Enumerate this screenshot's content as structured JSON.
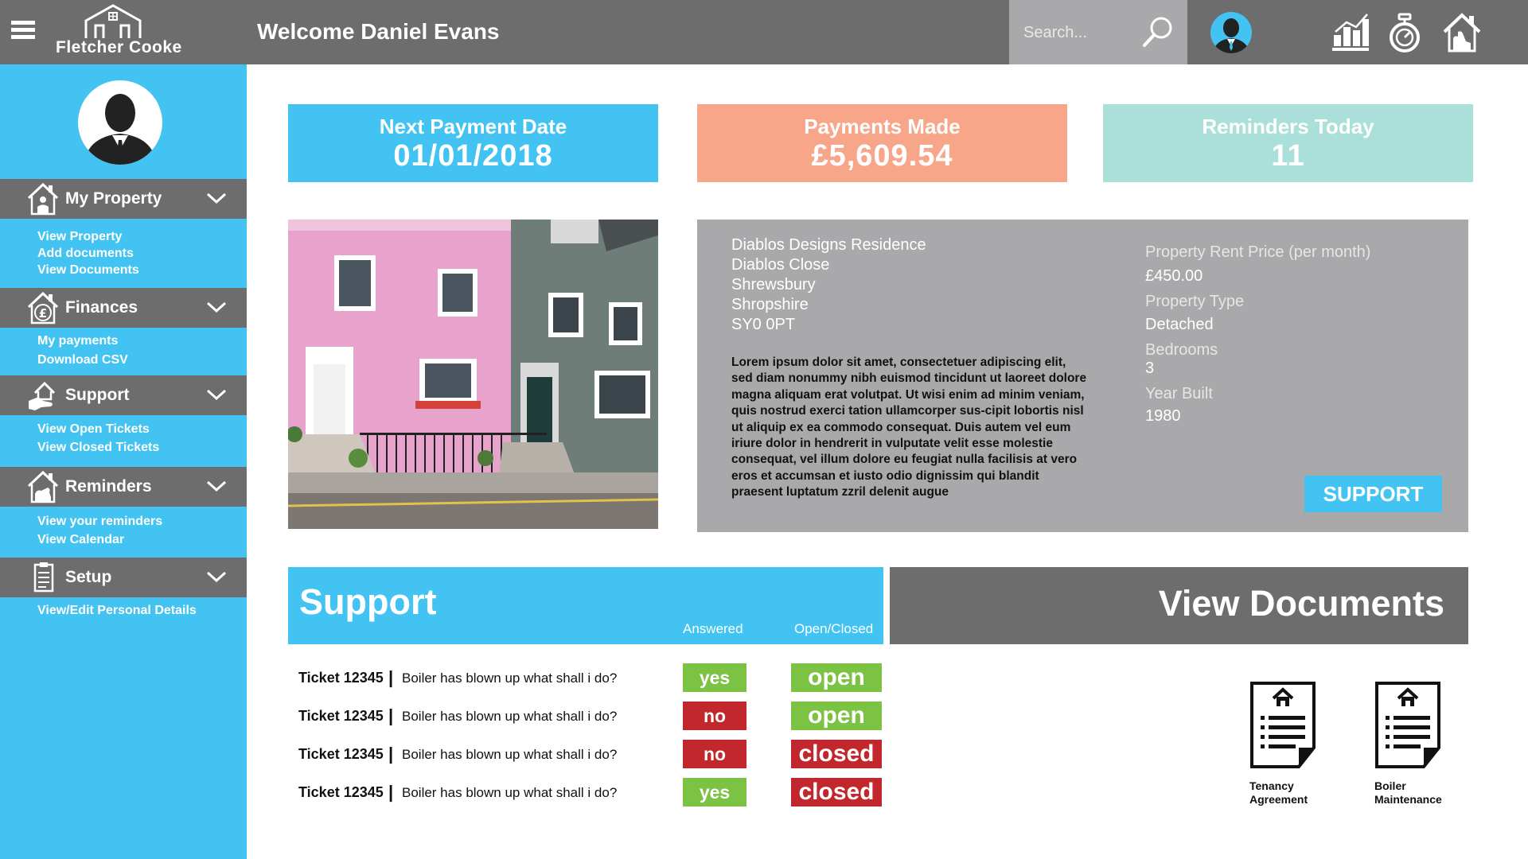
{
  "header": {
    "brand": "Fletcher Cooke",
    "welcome": "Welcome Daniel Evans",
    "search_placeholder": "Search...",
    "icons": [
      "menu-icon",
      "search-icon",
      "user-avatar",
      "stats-icon",
      "stopwatch-icon",
      "house-icon"
    ]
  },
  "sidebar": {
    "sections": [
      {
        "label": "My Property",
        "icon": "house-person-icon",
        "links": [
          "View Property",
          "Add documents",
          "View Documents"
        ]
      },
      {
        "label": "Finances",
        "icon": "house-pound-icon",
        "links": [
          "My payments",
          "Download CSV"
        ]
      },
      {
        "label": "Support",
        "icon": "hand-house-icon",
        "links": [
          "View Open Tickets",
          "View Closed Tickets"
        ]
      },
      {
        "label": "Reminders",
        "icon": "house-alert-icon",
        "links": [
          "View your reminders",
          "View Calendar"
        ]
      },
      {
        "label": "Setup",
        "icon": "checklist-icon",
        "links": [
          "View/Edit Personal Details"
        ]
      }
    ]
  },
  "stats": [
    {
      "label": "Next Payment Date",
      "value": "01/01/2018",
      "color": "#42c3f2"
    },
    {
      "label": "Payments Made",
      "value": "£5,609.54",
      "color": "#f7a68a"
    },
    {
      "label": "Reminders Today",
      "value": "11",
      "color": "#abdfd9"
    }
  ],
  "property": {
    "address": [
      "Diablos Designs Residence",
      "Diablos Close",
      "Shrewsbury",
      "Shropshire",
      "SY0 0PT"
    ],
    "description": "Lorem ipsum dolor sit amet, consectetuer adipiscing elit, sed diam nonummy nibh euismod tincidunt ut laoreet dolore magna aliquam erat volutpat. Ut wisi enim ad minim veniam, quis nostrud exerci tation ullamcorper sus-cipit lobortis nisl ut aliquip ex ea commodo consequat. Duis autem vel eum iriure dolor in hendrerit in vulputate velit esse molestie consequat, vel illum dolore eu feugiat nulla facilisis at vero eros et accumsan et iusto odio dignissim qui blandit praesent luptatum zzril delenit augue",
    "rent_label": "Property Rent Price (per month)",
    "rent_value": "£450.00",
    "type_label": "Property Type",
    "type_value": "Detached",
    "bedrooms_label": "Bedrooms",
    "bedrooms_value": "3",
    "year_label": "Year Built",
    "year_value": "1980",
    "support_button": "SUPPORT"
  },
  "support": {
    "title": "Support",
    "col_answered": "Answered",
    "col_status": "Open/Closed",
    "tickets": [
      {
        "id": "Ticket 12345",
        "sep": "|",
        "desc": "Boiler has blown up what shall i do?",
        "answered": "yes",
        "status": "open"
      },
      {
        "id": "Ticket 12345",
        "sep": "|",
        "desc": "Boiler has blown up what shall i do?",
        "answered": "no",
        "status": "open"
      },
      {
        "id": "Ticket 12345",
        "sep": "|",
        "desc": "Boiler has blown up what shall i do?",
        "answered": "no",
        "status": "closed"
      },
      {
        "id": "Ticket 12345",
        "sep": "|",
        "desc": "Boiler has blown up what shall i do?",
        "answered": "yes",
        "status": "closed"
      }
    ],
    "colors": {
      "positive": "#7cc243",
      "negative": "#c1272d"
    }
  },
  "documents": {
    "title": "View Documents",
    "items": [
      {
        "label_line1": "Tenancy",
        "label_line2": "Agreement",
        "icon": "document-icon"
      },
      {
        "label_line1": "Boiler",
        "label_line2": "Maintenance",
        "icon": "document-icon"
      }
    ]
  }
}
